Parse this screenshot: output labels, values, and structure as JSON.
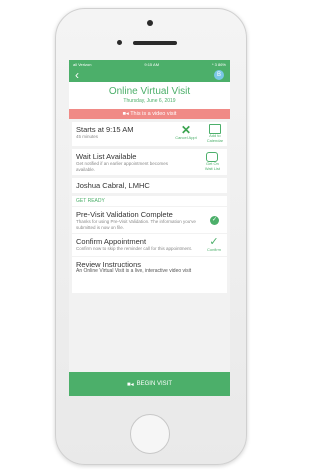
{
  "status": {
    "carrier": "all Verizon",
    "time": "9:15 AM",
    "battery": "* 3 86%"
  },
  "header": {
    "avatar_initial": "B"
  },
  "visit": {
    "title": "Online Virtual Visit",
    "date": "Thursday, June 6, 2019"
  },
  "banner": {
    "text": "This is a video visit"
  },
  "appointment": {
    "starts": "Starts at 9:15 AM",
    "duration": "45 minutes",
    "cancel_label": "Cancel Appt",
    "calendar_label_1": "Add to",
    "calendar_label_2": "Calendar"
  },
  "waitlist": {
    "title": "Wait List Available",
    "desc": "Get notified if an earlier appointment becomes available.",
    "action_1": "Get On",
    "action_2": "Wait List"
  },
  "provider": {
    "name": "Joshua Cabral, LMHC"
  },
  "section": {
    "get_ready": "GET READY"
  },
  "validation": {
    "title": "Pre-Visit Validation Complete",
    "desc": "Thanks for using Pre-Visit Validation. The information you've submitted is now on file."
  },
  "confirm": {
    "title": "Confirm Appointment",
    "desc": "Confirm now to skip the reminder call for this appointment.",
    "action": "Confirm"
  },
  "review": {
    "title": "Review Instructions",
    "desc": "An Online Virtual Visit is a live, interactive video visit"
  },
  "footer": {
    "begin_label": "BEGIN VISIT"
  }
}
